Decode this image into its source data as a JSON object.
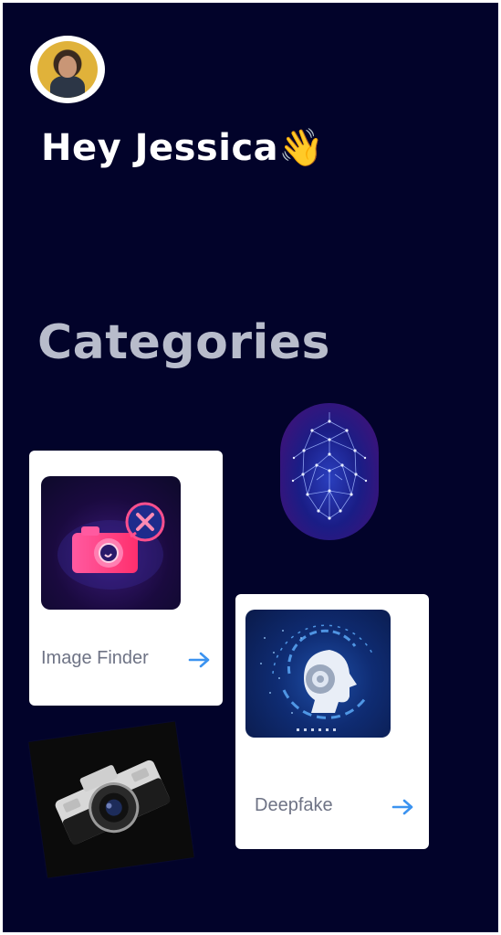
{
  "header": {
    "greeting": "Hey Jessica",
    "wave_emoji": "👋"
  },
  "sections": {
    "categories_title": "Categories"
  },
  "cards": [
    {
      "label": "Image Finder",
      "icon": "camera-search-icon",
      "action_icon": "arrow-right-icon"
    },
    {
      "label": "Deepfake",
      "icon": "ai-head-icon",
      "action_icon": "arrow-right-icon"
    }
  ],
  "colors": {
    "background": "#02032a",
    "card": "#ffffff",
    "accent_arrow": "#3b93f0",
    "title_muted": "#b8bccb",
    "label": "#6e7385"
  }
}
